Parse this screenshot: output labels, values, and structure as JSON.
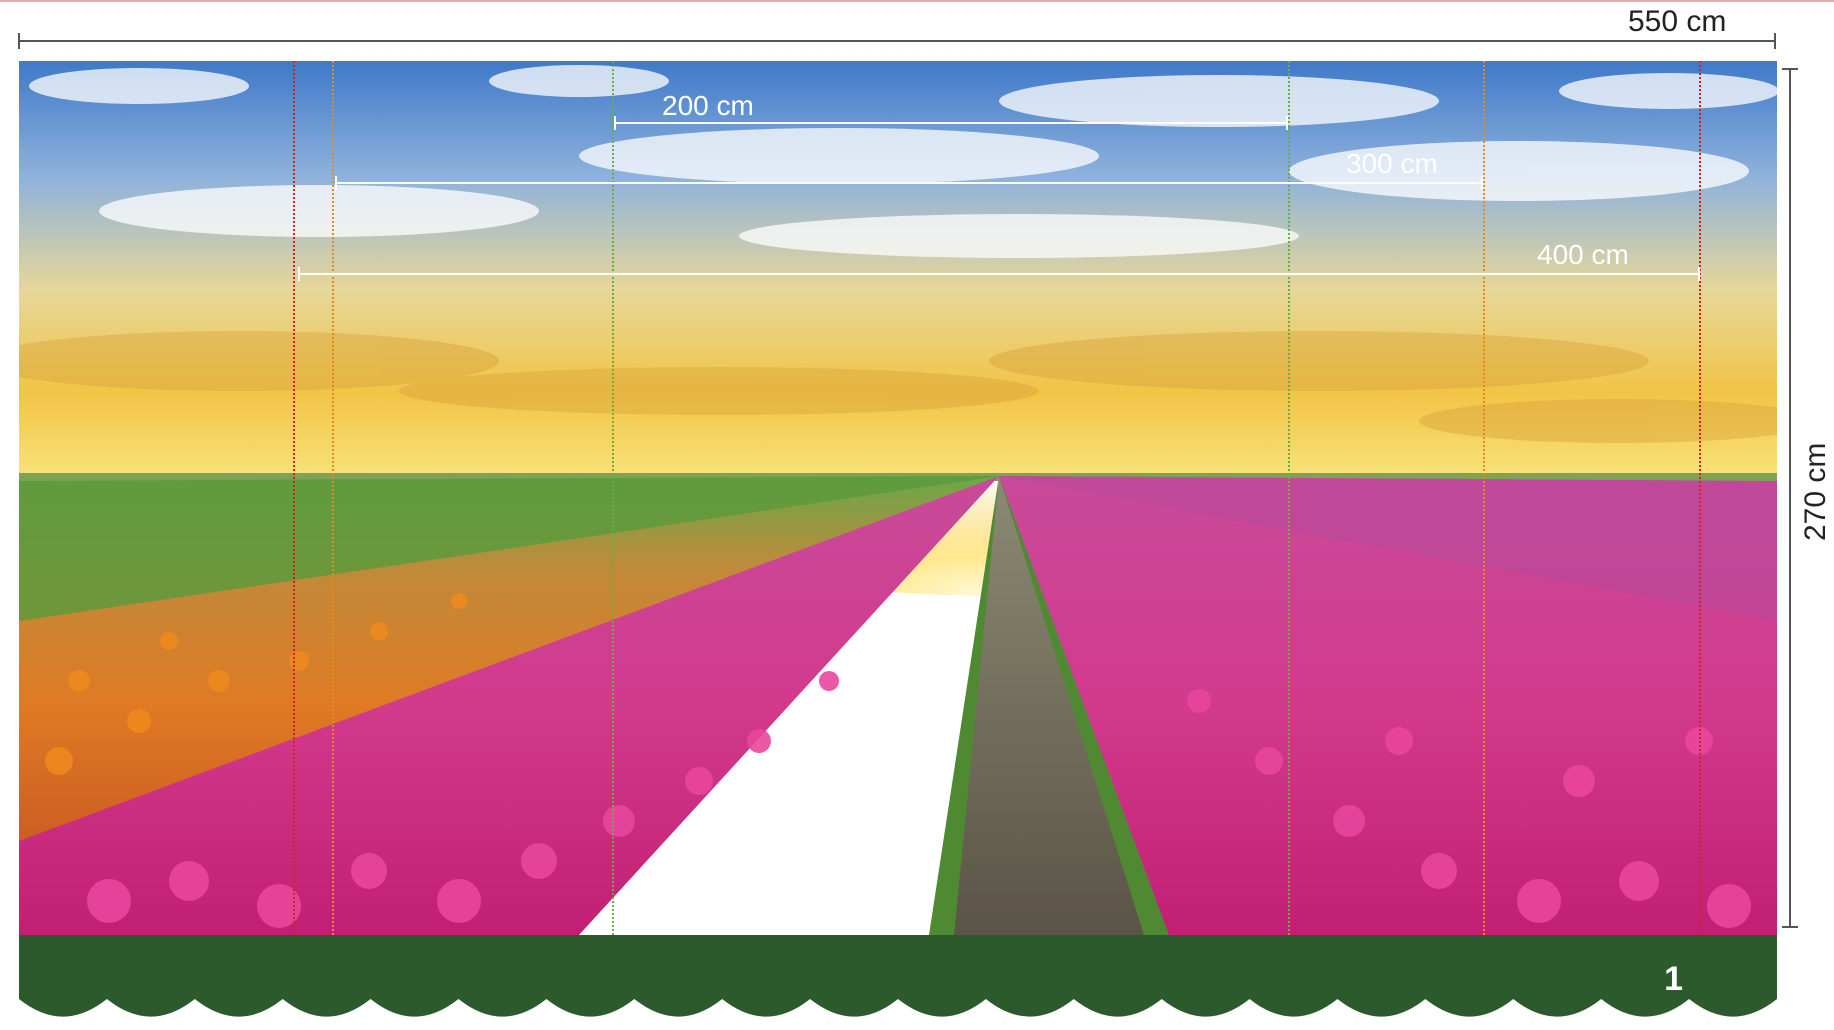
{
  "dimensions": {
    "width_label": "550 cm",
    "height_label": "270 cm"
  },
  "measures": [
    {
      "label": "200 cm",
      "color": "#6ab03a"
    },
    {
      "label": "300 cm",
      "color": "#e58a1e"
    },
    {
      "label": "400 cm",
      "color": "#d22222"
    }
  ],
  "footer": {
    "panel_number": "1",
    "color": "#2d5a2c"
  },
  "scene": {
    "image": "tulip-field-at-sunset",
    "flowers_left": "orange and red tulips",
    "flowers_right": "pink tulips"
  }
}
